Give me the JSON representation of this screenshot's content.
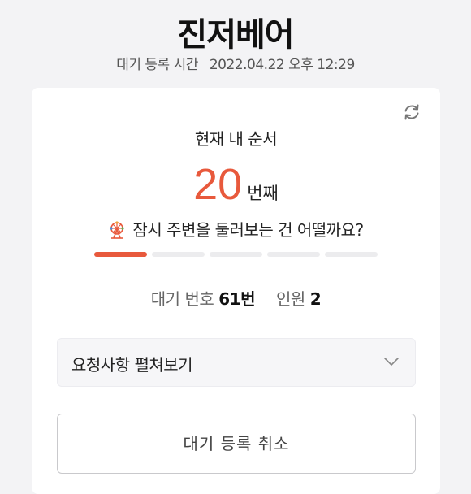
{
  "header": {
    "store_name": "진저베어",
    "registered_label": "대기 등록 시간",
    "registered_time": "2022.04.22 오후 12:29"
  },
  "queue": {
    "order_label": "현재 내 순서",
    "order_number": "20",
    "order_unit": "번째",
    "suggestion": "잠시 주변을 둘러보는 건 어떨까요?",
    "progress_segments": 5,
    "progress_active": 1,
    "waiting_number_label": "대기 번호",
    "waiting_number_value": "61번",
    "party_label": "인원",
    "party_value": "2"
  },
  "request": {
    "label": "요청사항 펼쳐보기"
  },
  "cancel": {
    "label": "대기 등록 취소"
  },
  "icons": {
    "refresh": "refresh-icon",
    "wheel": "ferris-wheel-icon",
    "chevron": "chevron-down-icon"
  },
  "colors": {
    "accent": "#e8593c",
    "background": "#f3f3f5",
    "card": "#ffffff"
  }
}
